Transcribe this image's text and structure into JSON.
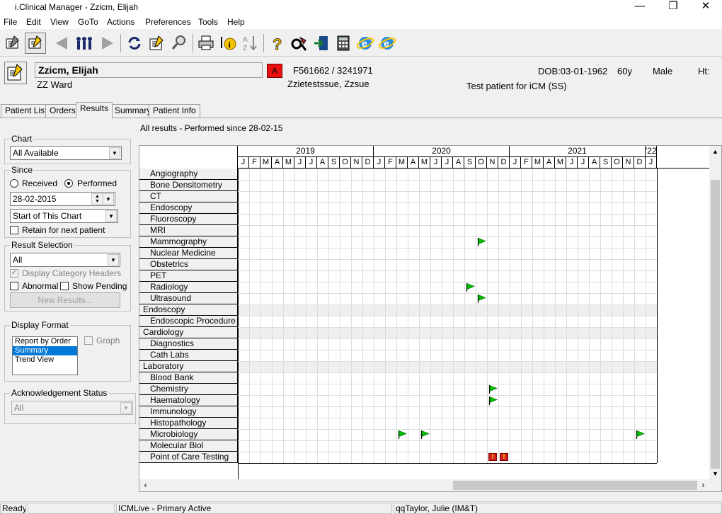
{
  "window": {
    "title": "i.Clinical Manager - Zzicm, Elijah",
    "minimize": "—",
    "restore": "❐",
    "close": "✕"
  },
  "menu": [
    "File",
    "Edit",
    "View",
    "GoTo",
    "Actions",
    "Preferences",
    "Tools",
    "Help"
  ],
  "toolbar_icons": [
    "patient-list-icon",
    "patient-open-icon",
    "back-icon",
    "people-icon",
    "forward-icon",
    "refresh-icon",
    "edit-notes-icon",
    "search-icon",
    "print-icon",
    "info-icon",
    "sort-az-icon",
    "help-icon",
    "tools-icon",
    "exit-icon",
    "calculator-icon",
    "internet-explorer-icon",
    "internet-explorer-icon-2"
  ],
  "patient": {
    "name": "Zzicm, Elijah",
    "ward": "ZZ Ward",
    "alert_badge": "A",
    "alert_color": "#e81010",
    "ids": "F561662 / 3241971",
    "gp": "Zzietestssue, Zzsue",
    "dob": "DOB:03-01-1962",
    "age": "60y",
    "sex": "Male",
    "ht": "Ht:",
    "note": "Test patient for iCM (SS)"
  },
  "tabs": [
    "Patient List",
    "Orders",
    "Results",
    "Summary",
    "Patient Info"
  ],
  "active_tab": "Results",
  "left_panel": {
    "chart": {
      "legend": "Chart",
      "value": "All Available"
    },
    "since": {
      "legend": "Since",
      "received": "Received",
      "performed": "Performed",
      "date": "28-02-2015",
      "range": "Start of This Chart",
      "retain": "Retain for next patient"
    },
    "result_selection": {
      "legend": "Result Selection",
      "value": "All",
      "display_headers": "Display Category Headers",
      "abnormal": "Abnormal",
      "show_pending": "Show Pending",
      "new_results": "New Results..."
    },
    "display_format": {
      "legend": "Display Format",
      "options": [
        "Report by Order",
        "Summary",
        "Trend View"
      ],
      "selected": "Summary",
      "graph": "Graph"
    },
    "acknowledgement": {
      "legend": "Acknowledgement Status",
      "value": "All"
    }
  },
  "results_header": "All results - Performed since 28-02-15",
  "grid": {
    "years": [
      "2019",
      "2020",
      "2021",
      "'22"
    ],
    "months": [
      "J",
      "F",
      "M",
      "A",
      "M",
      "J",
      "J",
      "A",
      "S",
      "O",
      "N",
      "D",
      "J",
      "F",
      "M",
      "A",
      "M",
      "J",
      "J",
      "A",
      "S",
      "O",
      "N",
      "D",
      "J",
      "F",
      "M",
      "A",
      "M",
      "J",
      "J",
      "A",
      "S",
      "O",
      "N",
      "D",
      "J"
    ],
    "rows": [
      {
        "label": "Angiography",
        "level": "sub"
      },
      {
        "label": "Bone Densitometry",
        "level": "sub"
      },
      {
        "label": "CT",
        "level": "sub"
      },
      {
        "label": "Endoscopy",
        "level": "sub"
      },
      {
        "label": "Fluoroscopy",
        "level": "sub"
      },
      {
        "label": "MRI",
        "level": "sub"
      },
      {
        "label": "Mammography",
        "level": "sub"
      },
      {
        "label": "Nuclear Medicine",
        "level": "sub"
      },
      {
        "label": "Obstetrics",
        "level": "sub"
      },
      {
        "label": "PET",
        "level": "sub"
      },
      {
        "label": "Radiology",
        "level": "sub"
      },
      {
        "label": "Ultrasound",
        "level": "sub"
      },
      {
        "label": "Endoscopy",
        "level": "cat"
      },
      {
        "label": "Endoscopic Procedure",
        "level": "sub"
      },
      {
        "label": "Cardiology",
        "level": "cat"
      },
      {
        "label": "Diagnostics",
        "level": "sub"
      },
      {
        "label": "Cath Labs",
        "level": "sub"
      },
      {
        "label": "Laboratory",
        "level": "cat"
      },
      {
        "label": "Blood Bank",
        "level": "sub"
      },
      {
        "label": "Chemistry",
        "level": "sub"
      },
      {
        "label": "Haematology",
        "level": "sub"
      },
      {
        "label": "Immunology",
        "level": "sub"
      },
      {
        "label": "Histopathology",
        "level": "sub"
      },
      {
        "label": "Microbiology",
        "level": "sub"
      },
      {
        "label": "Molecular Biol",
        "level": "sub"
      },
      {
        "label": "Point of Care Testing",
        "level": "sub"
      }
    ],
    "markers": [
      {
        "row": 6,
        "month": 21,
        "type": "flag"
      },
      {
        "row": 10,
        "month": 20,
        "type": "flag"
      },
      {
        "row": 11,
        "month": 21,
        "type": "flag"
      },
      {
        "row": 19,
        "month": 22,
        "type": "flag"
      },
      {
        "row": 20,
        "month": 22,
        "type": "flag"
      },
      {
        "row": 23,
        "month": 14,
        "type": "flag"
      },
      {
        "row": 23,
        "month": 16,
        "type": "flag"
      },
      {
        "row": 23,
        "month": 35,
        "type": "flag"
      },
      {
        "row": 25,
        "month": 22,
        "type": "alert"
      },
      {
        "row": 25,
        "month": 23,
        "type": "alert"
      }
    ],
    "flag_color": "#00c000"
  },
  "status": {
    "ready": "Ready",
    "blank": "",
    "system": "ICMLive - Primary Active",
    "user": "qqTaylor, Julie (IM&T)"
  }
}
